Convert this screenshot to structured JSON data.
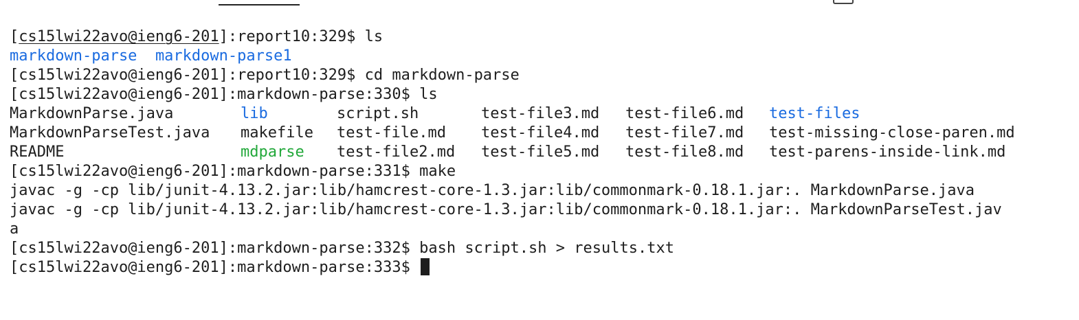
{
  "prompt": {
    "user_host": "cs15lwi22avo@ieng6-201"
  },
  "lines": {
    "l1": {
      "dir": "report10",
      "num": "329",
      "cmd": "ls"
    },
    "l2": {
      "a": "markdown-parse",
      "b": "markdown-parse1"
    },
    "l3": {
      "dir": "report10",
      "num": "329",
      "cmd": "cd markdown-parse"
    },
    "l4": {
      "dir": "markdown-parse",
      "num": "330",
      "cmd": "ls"
    },
    "l8": {
      "dir": "markdown-parse",
      "num": "331",
      "cmd": "make"
    },
    "l9": "javac -g -cp lib/junit-4.13.2.jar:lib/hamcrest-core-1.3.jar:lib/commonmark-0.18.1.jar:. MarkdownParse.java",
    "l10": "javac -g -cp lib/junit-4.13.2.jar:lib/hamcrest-core-1.3.jar:lib/commonmark-0.18.1.jar:. MarkdownParseTest.jav",
    "l11": "a",
    "l12": {
      "dir": "markdown-parse",
      "num": "332",
      "cmd": "bash script.sh > results.txt"
    },
    "l13": {
      "dir": "markdown-parse",
      "num": "333",
      "cmd": ""
    }
  },
  "listing": {
    "row1": [
      "MarkdownParse.java",
      "lib",
      "script.sh",
      "test-file3.md",
      "test-file6.md",
      "test-files"
    ],
    "row2": [
      "MarkdownParseTest.java",
      "makefile",
      "test-file.md",
      "test-file4.md",
      "test-file7.md",
      "test-missing-close-paren.md"
    ],
    "row3": [
      "README",
      "mdparse",
      "test-file2.md",
      "test-file5.md",
      "test-file8.md",
      "test-parens-inside-link.md"
    ]
  },
  "colors": {
    "text": "#1e1e1e",
    "directory": "#1a6be0",
    "executable": "#22a83a",
    "background": "#ffffff"
  }
}
